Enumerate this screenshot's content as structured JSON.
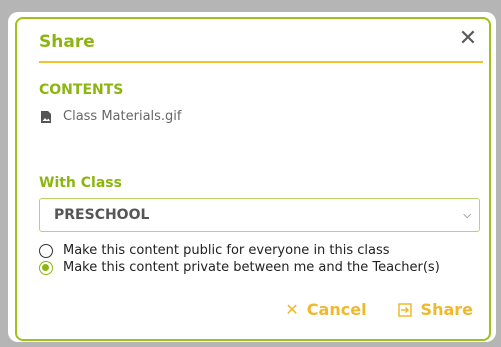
{
  "dialog": {
    "title": "Share",
    "close_icon": "close-icon"
  },
  "contents": {
    "label": "CONTENTS",
    "file_name": "Class Materials.gif",
    "file_icon": "image-file-icon"
  },
  "with_class": {
    "label": "With Class",
    "selected": "PRESCHOOL"
  },
  "visibility": {
    "options": [
      {
        "label": "Make this content public for everyone in this class",
        "checked": false
      },
      {
        "label": "Make this content private between me and the Teacher(s)",
        "checked": true
      }
    ]
  },
  "actions": {
    "cancel_label": "Cancel",
    "share_label": "Share"
  },
  "colors": {
    "accent_green": "#8db510",
    "accent_yellow": "#f2b82b",
    "border_green": "#9ec21a"
  }
}
